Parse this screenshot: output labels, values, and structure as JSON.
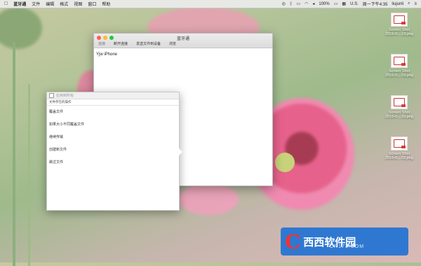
{
  "menubar": {
    "apple": "",
    "app_name": "蓝牙通",
    "menus": [
      "文件",
      "编辑",
      "格式",
      "视图",
      "窗口",
      "帮助"
    ],
    "status": {
      "battery": "100%",
      "input": "U.S.",
      "clock": "周一下午4:35",
      "user": "liujunli"
    }
  },
  "window": {
    "title": "蓝牙通",
    "toolbar": [
      "连接",
      "断开连接",
      "发送文件到设备",
      "浏览"
    ],
    "device": "Yjw iPhone"
  },
  "sheet": {
    "apply_all": "应用到所有",
    "caption": "文件存在的操作",
    "options": [
      "覆盖文件",
      "如果大小不同覆盖文件",
      "继续传输",
      "创建新文件",
      "跳过文件"
    ]
  },
  "desktop": [
    {
      "line1": "Screen Shot",
      "line2": "2015-0....13.png"
    },
    {
      "line1": "Screen Shot",
      "line2": "2015-0....03.png"
    },
    {
      "line1": "Screen Shot",
      "line2": "2015-0....32.png"
    },
    {
      "line1": "Screen Shot",
      "line2": "2015-0....02.png"
    }
  ],
  "watermark": {
    "logo": "C",
    "title": "西西软件园",
    "url": "CR173.COM"
  },
  "colors": {
    "accent": "#2f78d1",
    "close": "#ff5f57",
    "minimize": "#febc2e",
    "zoom": "#28c840"
  }
}
